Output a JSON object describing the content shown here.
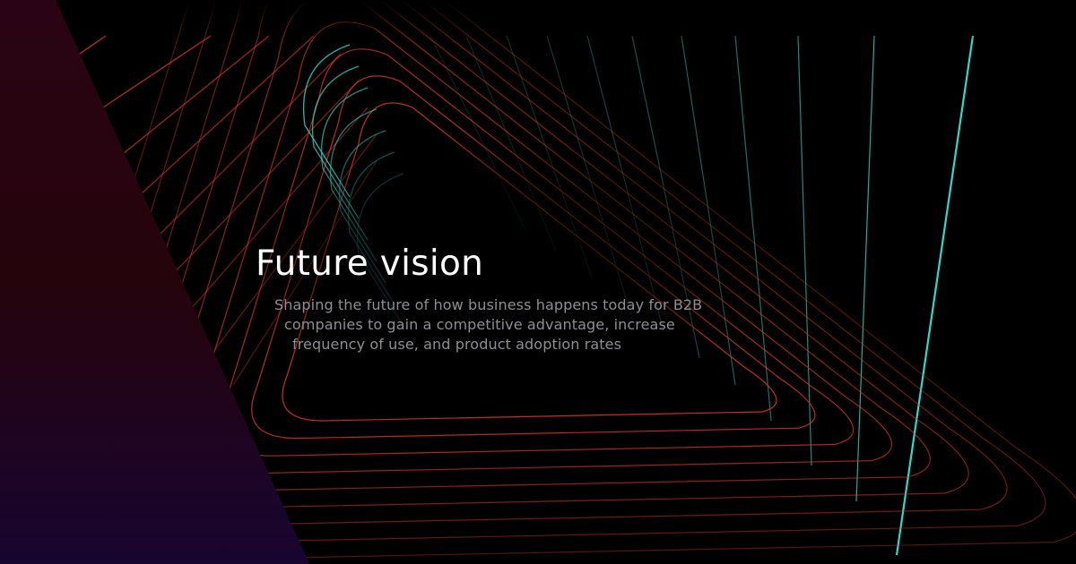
{
  "hero": {
    "title": "Future vision",
    "subtitle_lines": [
      "Shaping the future of how business happens today for B2B",
      "companies to gain a competitive advantage, increase",
      "frequency of use, and product adoption rates"
    ]
  },
  "colors": {
    "background": "#000000",
    "title": "#ffffff",
    "subtitle": "#8e8e95",
    "lines_warm": "#e8362c",
    "lines_cool": "#2ee6d6",
    "panel_top": "#2a0612",
    "panel_bottom": "#1a0630"
  }
}
